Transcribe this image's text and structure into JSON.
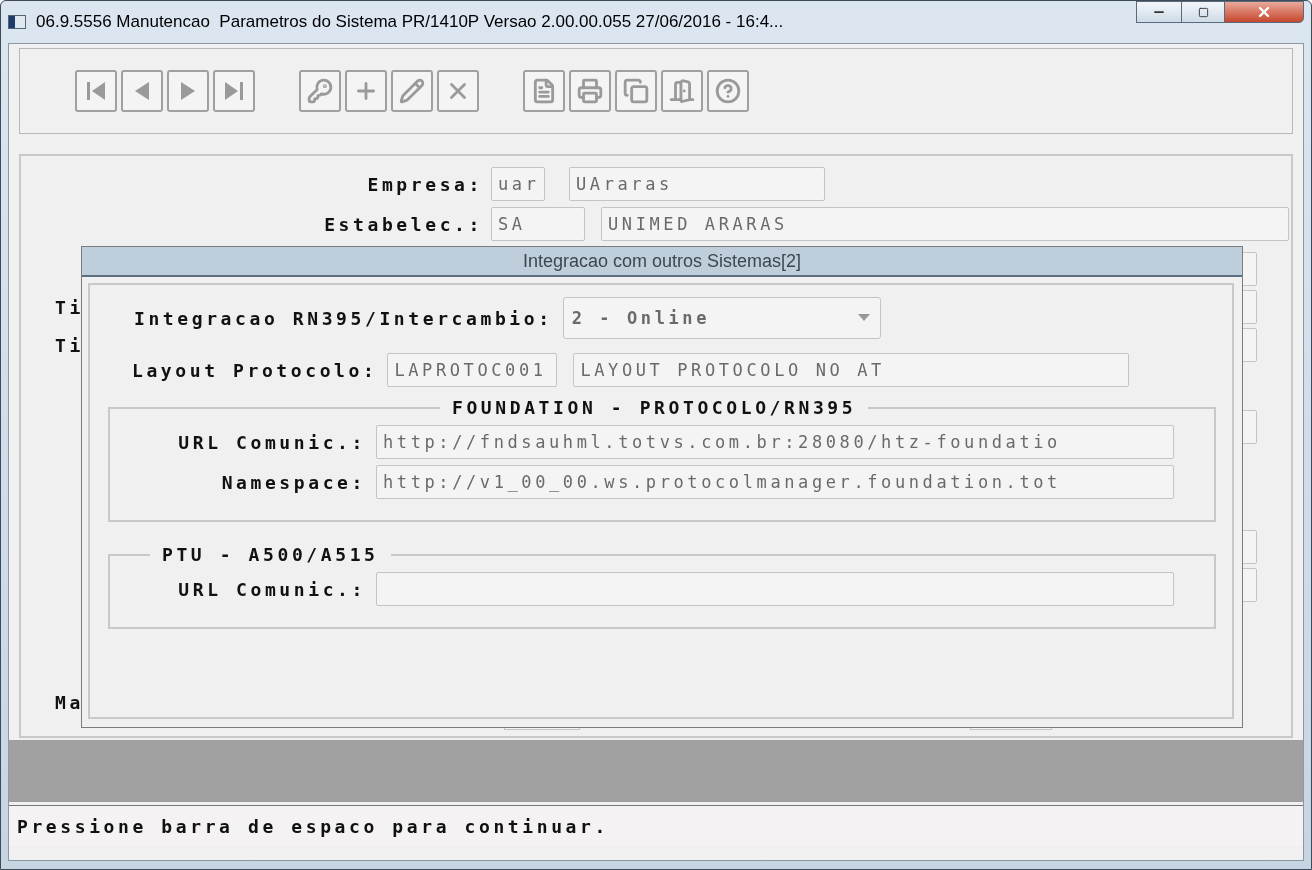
{
  "window": {
    "title": "06.9.5556 Manutencao  Parametros do Sistema PR/1410P Versao 2.00.00.055 27/06/2016 - 16:4..."
  },
  "toolbar": {
    "groups": [
      [
        {
          "kind": "first"
        },
        {
          "kind": "prev"
        },
        {
          "kind": "next"
        },
        {
          "kind": "last"
        }
      ],
      [
        {
          "kind": "key"
        },
        {
          "kind": "add"
        },
        {
          "kind": "edit"
        },
        {
          "kind": "delete"
        }
      ],
      [
        {
          "kind": "filter"
        },
        {
          "kind": "print"
        },
        {
          "kind": "copy"
        },
        {
          "kind": "exit"
        },
        {
          "kind": "help"
        }
      ]
    ]
  },
  "form": {
    "fields": [
      {
        "label": "Empresa:",
        "code": "uar",
        "name": "UAraras"
      },
      {
        "label": "Estabelec.:",
        "code": "SA",
        "name": "UNIMED ARARAS"
      }
    ],
    "background_rows": [
      {},
      {
        "label": "Ti"
      },
      {
        "label": "Ti"
      },
      {},
      {},
      {}
    ],
    "bottom_label": "Ma"
  },
  "dialog": {
    "title": "Integracao com outros Sistemas[2]",
    "integration": {
      "label": "Integracao RN395/Intercambio:",
      "value": "2 - Online"
    },
    "layout": {
      "label": "Layout Protocolo:",
      "code": "LAPROTOC001",
      "name": "LAYOUT PROTOCOLO NO AT"
    },
    "groups": [
      {
        "legend": "FOUNDATION - PROTOCOLO/RN395",
        "fields": [
          {
            "label": "URL Comunic.:",
            "value": "http://fndsauhml.totvs.com.br:28080/htz-foundatio"
          },
          {
            "label": "Namespace:",
            "value": "http://v1_00_00.ws.protocolmanager.foundation.tot"
          }
        ]
      },
      {
        "legend": "PTU - A500/A515",
        "fields": [
          {
            "label": "URL Comunic.:"
          }
        ]
      }
    ]
  },
  "status_bar": {
    "text": "Pressione barra de espaco para continuar."
  }
}
